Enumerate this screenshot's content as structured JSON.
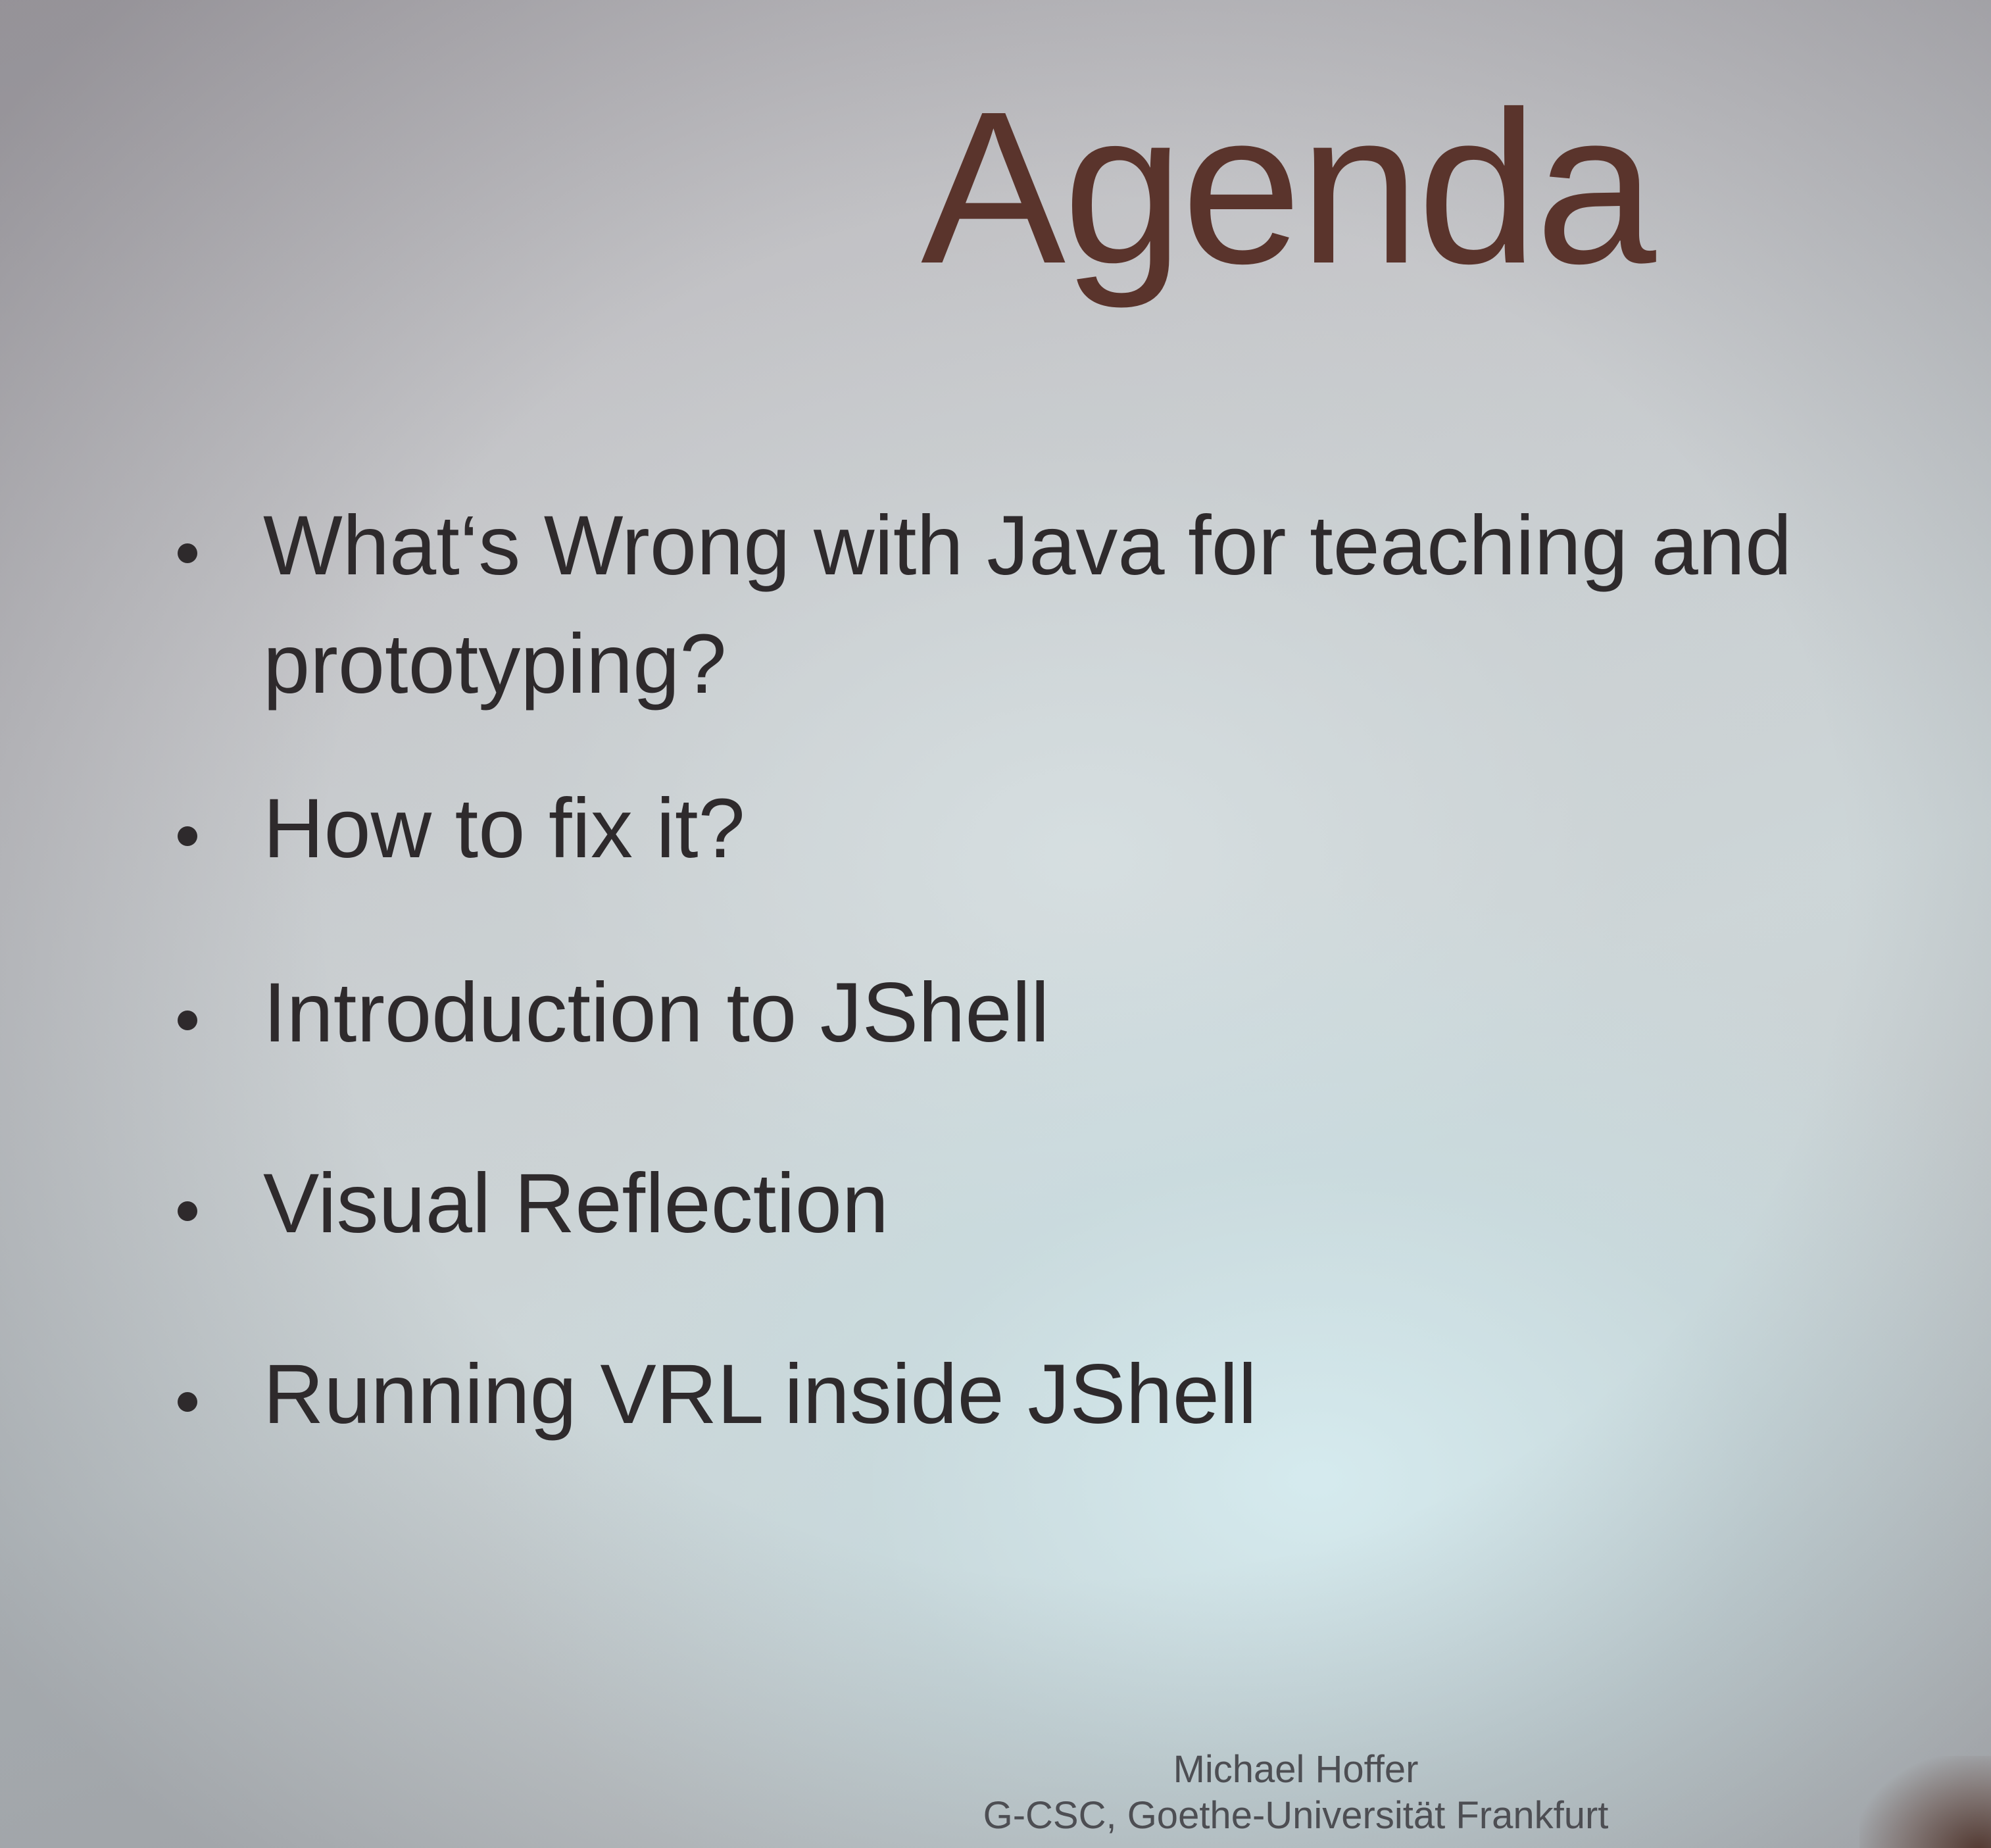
{
  "slide": {
    "title": "Agenda",
    "bullets": [
      {
        "line1": "What‘s Wrong with Java for teaching and",
        "line2": "prototyping?"
      },
      {
        "line1": "How to fix it?"
      },
      {
        "line1": "Introduction to JShell"
      },
      {
        "line1": "Visual Reflection"
      },
      {
        "line1": "Running VRL inside JShell"
      }
    ],
    "footer": {
      "author": "Michael Hoffer",
      "affiliation": "G-CSC, Goethe-Universität Frankfurt"
    }
  },
  "colors": {
    "title": "#5a342c",
    "body_text": "#2e2a2c",
    "footer_text": "#4d4e53"
  }
}
